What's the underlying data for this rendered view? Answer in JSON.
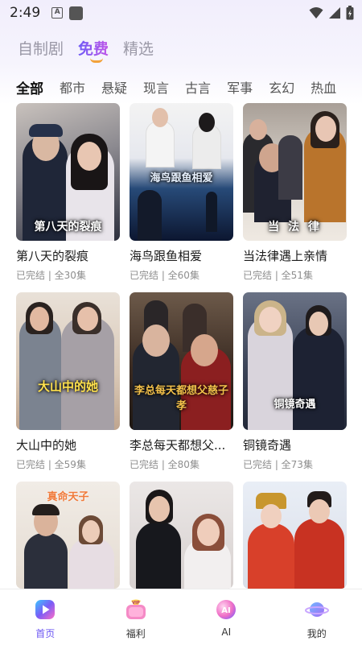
{
  "status": {
    "time": "2:49"
  },
  "top_tabs": [
    {
      "label": "自制剧",
      "active": false
    },
    {
      "label": "免费",
      "active": true
    },
    {
      "label": "精选",
      "active": false
    }
  ],
  "categories": [
    "全部",
    "都市",
    "悬疑",
    "现言",
    "古言",
    "军事",
    "玄幻",
    "热血"
  ],
  "shows": [
    {
      "title": "第八天的裂痕",
      "meta": "已完结 | 全30集",
      "poster_text": "第八天的裂痕"
    },
    {
      "title": "海鸟跟鱼相爱",
      "meta": "已完结 | 全60集",
      "poster_text": "海鸟跟鱼相爱"
    },
    {
      "title": "当法律遇上亲情",
      "meta": "已完结 | 全51集",
      "poster_text": "当 法 律"
    },
    {
      "title": "大山中的她",
      "meta": "已完结 | 全59集",
      "poster_text": "大山中的她"
    },
    {
      "title": "李总每天都想父...",
      "meta": "已完结 | 全80集",
      "poster_text": "李总每天都想父慈子孝"
    },
    {
      "title": "铜镜奇遇",
      "meta": "已完结 | 全73集",
      "poster_text": "铜镜奇遇"
    },
    {
      "title": "",
      "meta": "",
      "poster_text": "真命天子"
    },
    {
      "title": "",
      "meta": "",
      "poster_text": ""
    },
    {
      "title": "",
      "meta": "",
      "poster_text": ""
    }
  ],
  "bottom_nav": [
    {
      "label": "首页",
      "icon": "home-play-icon",
      "active": true
    },
    {
      "label": "福利",
      "icon": "vip-gift-icon",
      "active": false
    },
    {
      "label": "AI",
      "icon": "ai-orb-icon",
      "active": false
    },
    {
      "label": "我的",
      "icon": "planet-profile-icon",
      "active": false
    }
  ],
  "colors": {
    "accent": "#6b55f2",
    "underline": "#f2a23a"
  }
}
